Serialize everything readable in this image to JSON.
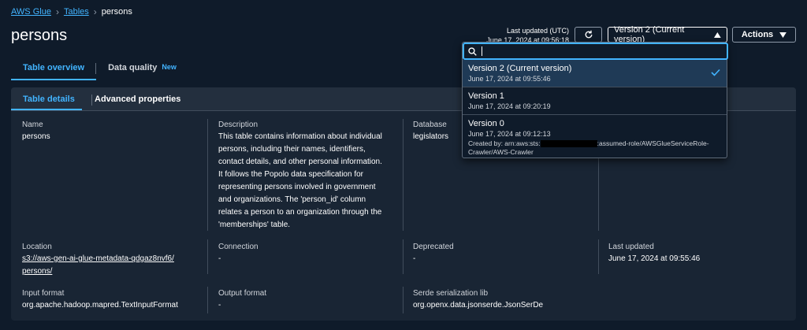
{
  "breadcrumb": {
    "root": "AWS Glue",
    "tables": "Tables",
    "current": "persons"
  },
  "page_title": "persons",
  "header": {
    "last_updated_label": "Last updated (UTC)",
    "last_updated_value": "June 17, 2024 at 09:56:18",
    "version_selected": "Version 2 (Current version)",
    "actions_label": "Actions"
  },
  "top_tabs": [
    {
      "label": "Table overview",
      "active": true
    },
    {
      "label": "Data quality",
      "badge": "New",
      "active": false
    }
  ],
  "panel_tabs": [
    {
      "label": "Table details",
      "active": true
    },
    {
      "label": "Advanced properties",
      "active": false
    }
  ],
  "details": {
    "name_label": "Name",
    "name_value": "persons",
    "description_label": "Description",
    "description_lines": [
      "This table contains information about individual",
      "persons, including their names, identifiers,",
      "contact details, and other personal information.",
      "It follows the Popolo data specification for",
      "representing persons involved in government",
      "and organizations. The 'person_id' column",
      "relates a person to an organization through the",
      "'memberships' table."
    ],
    "database_label": "Database",
    "database_value": "legislators",
    "location_label": "Location",
    "location_line1": "s3://aws-gen-ai-glue-metadata-qdgaz8nvf6/",
    "location_line2": "persons/",
    "connection_label": "Connection",
    "connection_value": "-",
    "deprecated_label": "Deprecated",
    "deprecated_value": "-",
    "last_updated_label": "Last updated",
    "last_updated_value": "June 17, 2024 at 09:55:46",
    "input_format_label": "Input format",
    "input_format_value": "org.apache.hadoop.mapred.TextInputFormat",
    "output_format_label": "Output format",
    "output_format_value": "-",
    "serde_label": "Serde serialization lib",
    "serde_value": "org.openx.data.jsonserde.JsonSerDe"
  },
  "dropdown": {
    "search_value": "",
    "options": [
      {
        "title": "Version 2 (Current version)",
        "date": "June 17, 2024 at 09:55:46",
        "selected": true
      },
      {
        "title": "Version 1",
        "date": "June 17, 2024 at 09:20:19"
      },
      {
        "title": "Version 0",
        "date": "June 17, 2024 at 09:12:13",
        "desc_prefix": "Created by: arn:aws:sts:",
        "desc_suffix": ":assumed-role/AWSGlueServiceRole-",
        "desc_line2": "Crawler/AWS-Crawler"
      }
    ]
  },
  "colors": {
    "accent": "#42b4ff",
    "background": "#0f1b2a",
    "panel": "#192534"
  }
}
